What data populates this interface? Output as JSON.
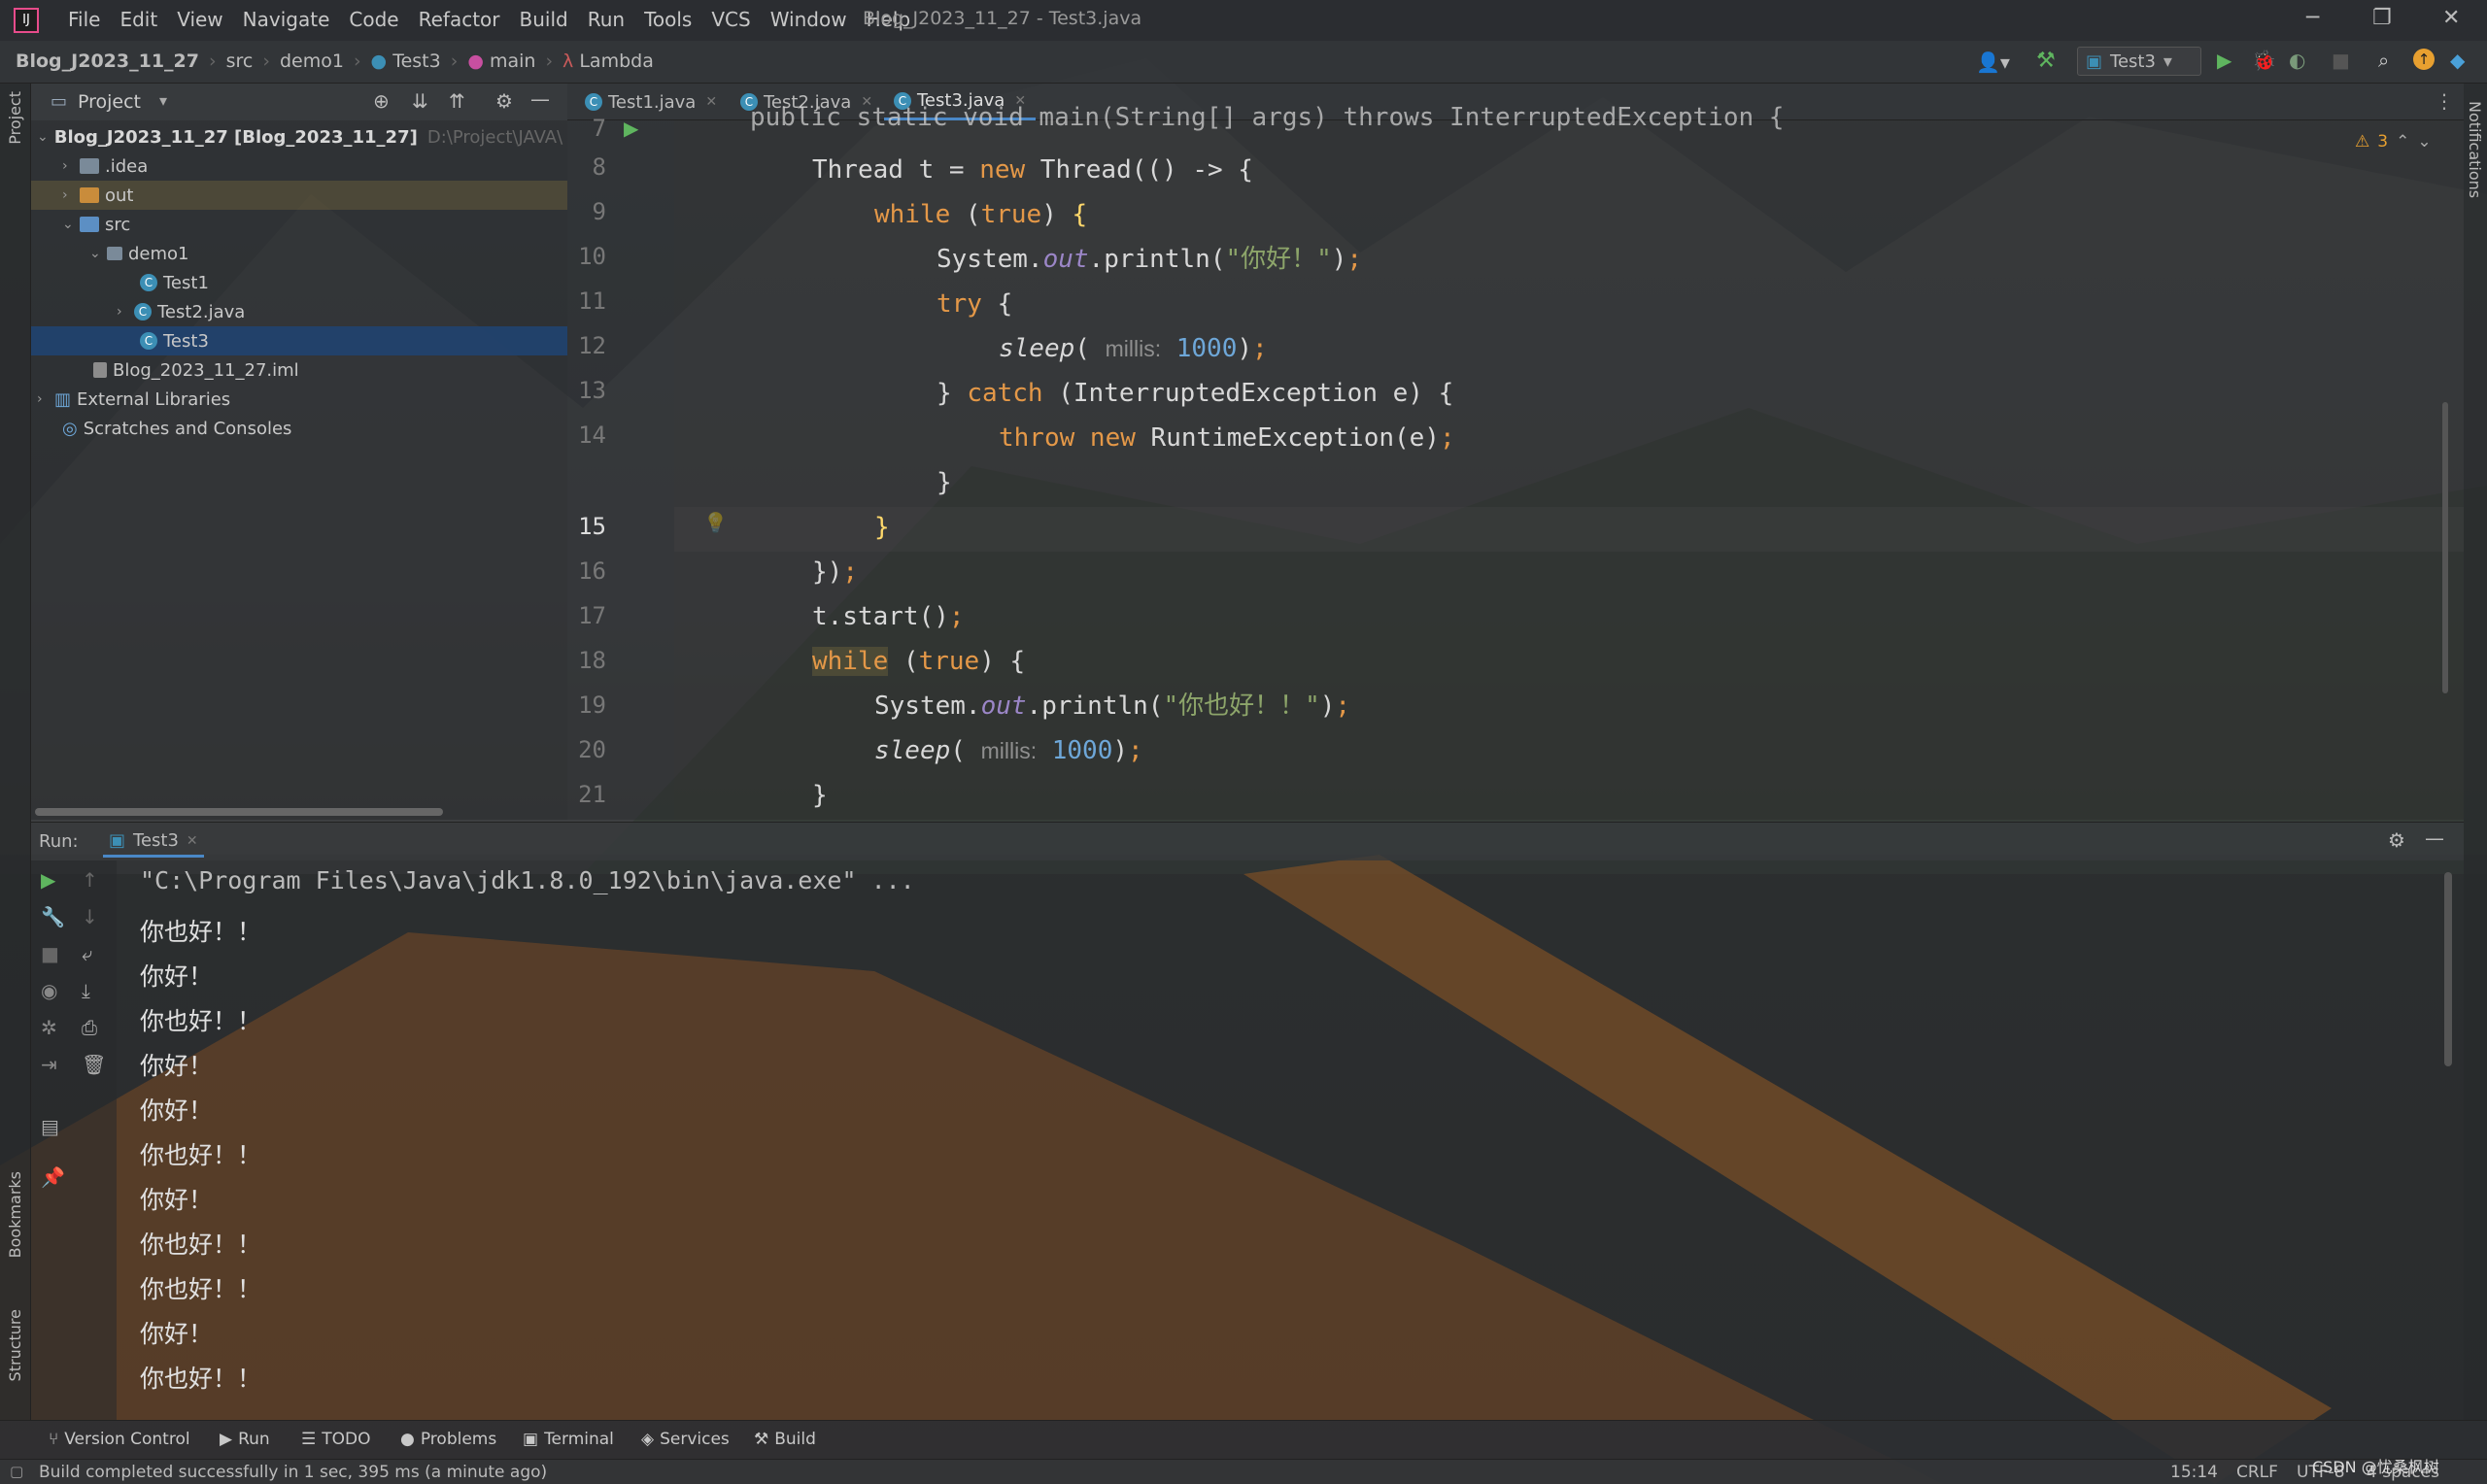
{
  "app": {
    "title": "Blog_J2023_11_27 - Test3.java",
    "logo": "IJ"
  },
  "menu": [
    "File",
    "Edit",
    "View",
    "Navigate",
    "Code",
    "Refactor",
    "Build",
    "Run",
    "Tools",
    "VCS",
    "Window",
    "Help"
  ],
  "breadcrumbs": [
    "Blog_J2023_11_27",
    "src",
    "demo1",
    "Test3",
    "main",
    "Lambda"
  ],
  "run_config": "Test3",
  "project": {
    "title": "Project",
    "root": "Blog_J2023_11_27 [Blog_2023_11_27]",
    "root_path": "D:\\Project\\JAVA\\",
    "nodes": [
      ".idea",
      "out",
      "src",
      "demo1",
      "Test1",
      "Test2.java",
      "Test3",
      "Blog_2023_11_27.iml",
      "External Libraries",
      "Scratches and Consoles"
    ]
  },
  "tabs": [
    "Test1.java",
    "Test2.java",
    "Test3.java"
  ],
  "editor": {
    "inspection": "3",
    "partial_line": "public static void main(String[] args) throws InterruptedException {",
    "line_numbers": [
      "7",
      "8",
      "9",
      "10",
      "11",
      "12",
      "13",
      "14",
      "15",
      "16",
      "17",
      "18",
      "19",
      "20",
      "21"
    ],
    "hint_label": "millis:",
    "sleep_arg": "1000",
    "str1": "\"你好！\"",
    "str2": "\"你也好！！\""
  },
  "run": {
    "label": "Run:",
    "tab": "Test3",
    "cmd": "\"C:\\Program Files\\Java\\jdk1.8.0_192\\bin\\java.exe\" ...",
    "output": [
      "你也好！！",
      "你好！",
      "你也好！！",
      "你好！",
      "你好！",
      "你也好！！",
      "你好！",
      "你也好！！",
      "你也好！！",
      "你好！",
      "你也好！！"
    ]
  },
  "toolwindows": [
    "Version Control",
    "Run",
    "TODO",
    "Problems",
    "Terminal",
    "Services",
    "Build"
  ],
  "side": {
    "left": [
      "Project",
      "Bookmarks",
      "Structure"
    ],
    "right": "Notifications"
  },
  "status": {
    "message": "Build completed successfully in 1 sec, 395 ms (a minute ago)",
    "position": "15:14",
    "line_sep": "CRLF",
    "encoding": "UTF-8",
    "indent": "4 spaces",
    "watermark": "CSDN @忧桑枫树"
  }
}
